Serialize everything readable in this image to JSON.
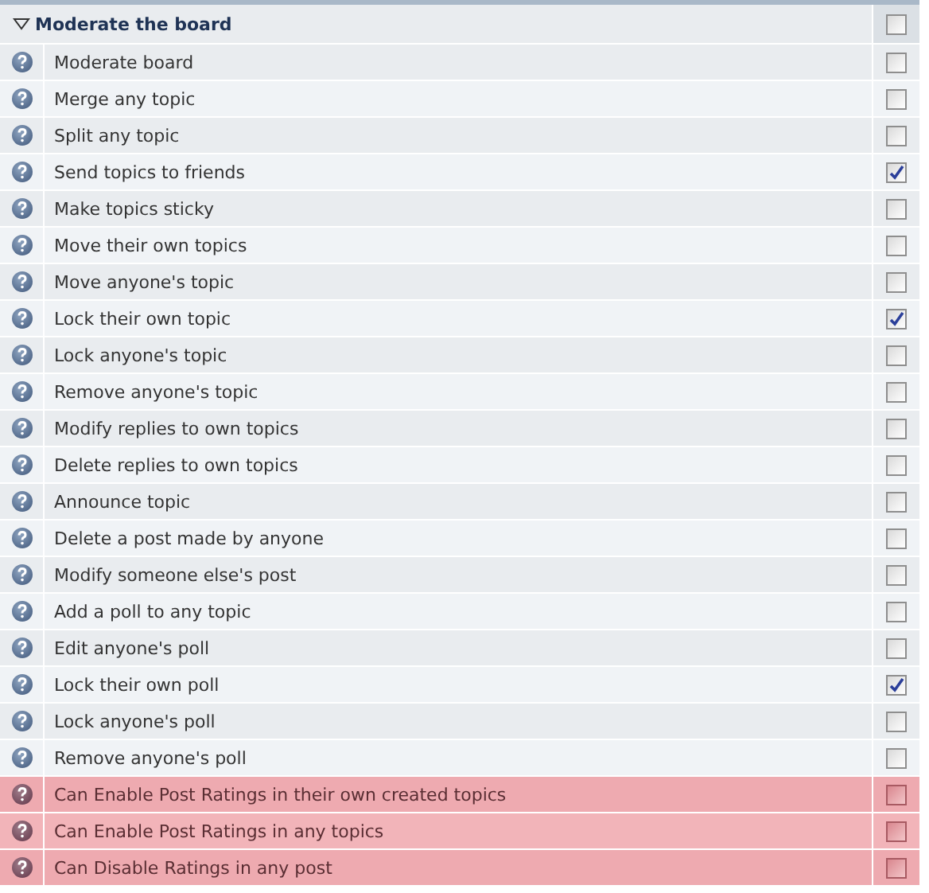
{
  "section": {
    "title": "Moderate the board",
    "expanded": true,
    "checked": false
  },
  "permissions": [
    {
      "label": "Moderate board",
      "checked": false,
      "highlighted": false
    },
    {
      "label": "Merge any topic",
      "checked": false,
      "highlighted": false
    },
    {
      "label": "Split any topic",
      "checked": false,
      "highlighted": false
    },
    {
      "label": "Send topics to friends",
      "checked": true,
      "highlighted": false
    },
    {
      "label": "Make topics sticky",
      "checked": false,
      "highlighted": false
    },
    {
      "label": "Move their own topics",
      "checked": false,
      "highlighted": false
    },
    {
      "label": "Move anyone's topic",
      "checked": false,
      "highlighted": false
    },
    {
      "label": "Lock their own topic",
      "checked": true,
      "highlighted": false
    },
    {
      "label": "Lock anyone's topic",
      "checked": false,
      "highlighted": false
    },
    {
      "label": "Remove anyone's topic",
      "checked": false,
      "highlighted": false
    },
    {
      "label": "Modify replies to own topics",
      "checked": false,
      "highlighted": false
    },
    {
      "label": "Delete replies to own topics",
      "checked": false,
      "highlighted": false
    },
    {
      "label": "Announce topic",
      "checked": false,
      "highlighted": false
    },
    {
      "label": "Delete a post made by anyone",
      "checked": false,
      "highlighted": false
    },
    {
      "label": "Modify someone else's post",
      "checked": false,
      "highlighted": false
    },
    {
      "label": "Add a poll to any topic",
      "checked": false,
      "highlighted": false
    },
    {
      "label": "Edit anyone's poll",
      "checked": false,
      "highlighted": false
    },
    {
      "label": "Lock their own poll",
      "checked": true,
      "highlighted": false
    },
    {
      "label": "Lock anyone's poll",
      "checked": false,
      "highlighted": false
    },
    {
      "label": "Remove anyone's poll",
      "checked": false,
      "highlighted": false
    },
    {
      "label": "Can Enable Post Ratings in their own created topics",
      "checked": false,
      "highlighted": true
    },
    {
      "label": "Can Enable Post Ratings in any topics",
      "checked": false,
      "highlighted": true
    },
    {
      "label": "Can Disable Ratings in any post",
      "checked": false,
      "highlighted": true
    }
  ]
}
